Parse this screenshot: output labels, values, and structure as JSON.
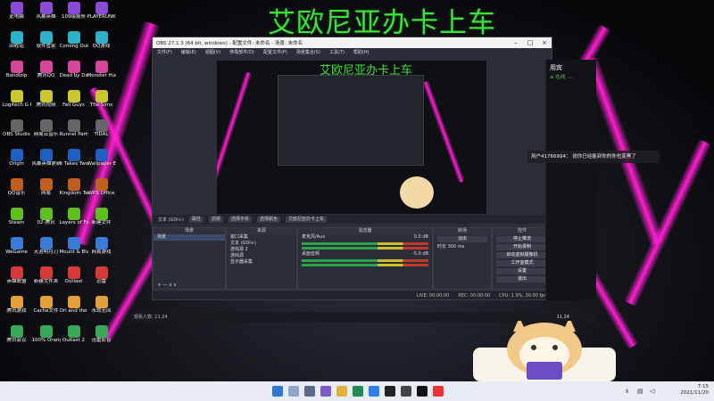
{
  "banner": "艾欧尼亚办卡上车",
  "desktop_icons_col1": [
    "此电脑",
    "回收站",
    "Bandizip",
    "Logitech G HUB",
    "OBS Studio",
    "Origin",
    "QQ音乐",
    "Steam",
    "WeGame",
    "英雄联盟",
    "腾讯游戏",
    "腾讯会议"
  ],
  "desktop_icons_col2": [
    "风暴英雄",
    "软件管家",
    "腾讯QQ",
    "腾讯视频",
    "网易云音乐",
    "风暴英雄更新",
    "网易",
    "02-腾讯",
    "天涯明月刀",
    "新建文件夹",
    "Cache文件",
    "100% Orange"
  ],
  "desktop_icons_col3": [
    "109级服务",
    "Coming Out on Top",
    "Dead by Daylight",
    "Fall Guys",
    "Runnel Party",
    "It Takes Two",
    "Kingdom Two",
    "Layers of Fear",
    "Mount & Blade",
    "Outlast",
    "Ori and the Will",
    "Outlast 2"
  ],
  "desktop_icons_col4": [
    "PLAYERUNKNOWN",
    "QQ游戏",
    "Monster Hunter",
    "The Sims",
    "TIDAL",
    "Wallpaper Engine",
    "WPS Office",
    "新建文件",
    "网易游戏",
    "迅雷",
    "永劫无间",
    "迅雷影音"
  ],
  "obs": {
    "title": "OBS 27.1.3 (64 bit, windows) - 配置文件: 未命名 - 场景: 未命名",
    "menu": [
      "文件(F)",
      "编辑(E)",
      "视图(V)",
      "停靠部件(D)",
      "配置文件(P)",
      "场景集合(S)",
      "工具(T)",
      "帮助(H)"
    ],
    "preview_banner": "艾欧尼亚办卡上车",
    "source_bar": [
      "文本 (GDI+)",
      "属性",
      "滤镜",
      "选择字体",
      "选择颜色",
      "艾欧尼亚办卡上车"
    ],
    "docks": {
      "scenes": {
        "title": "场景",
        "items": [
          "场景"
        ]
      },
      "sources": {
        "title": "来源",
        "items": [
          "窗口采集",
          "文本 (GDI+)",
          "游戏源 2",
          "游戏源",
          "显示器采集"
        ]
      },
      "mixer": {
        "title": "混音器",
        "items": [
          "麦克风/Aux",
          "桌面音频"
        ],
        "levels": [
          "0.0 dB",
          "-5.0 dB"
        ]
      },
      "transitions": {
        "title": "转场",
        "mode": "淡出",
        "duration_label": "时长",
        "duration": "300 ms"
      },
      "controls": {
        "title": "控件",
        "buttons": [
          "停止推流",
          "开始录制",
          "启动虚拟摄像机",
          "工作室模式",
          "设置",
          "退出"
        ]
      }
    },
    "status": [
      "LIVE: 00:00:00",
      "REC: 00:00:00",
      "CPU: 1.9%, 30.00 fps"
    ]
  },
  "right_app": {
    "title": "用宾",
    "sub": "≤ 在线 ...."
  },
  "chat_message": "用户41766994：  说你已经能到你的你也变黑了",
  "ctrl_bar": {
    "meta": "观看人数: 11.24",
    "value": "11.24"
  },
  "taskbar": {
    "time": "7:15",
    "date": "2021/11/20"
  }
}
